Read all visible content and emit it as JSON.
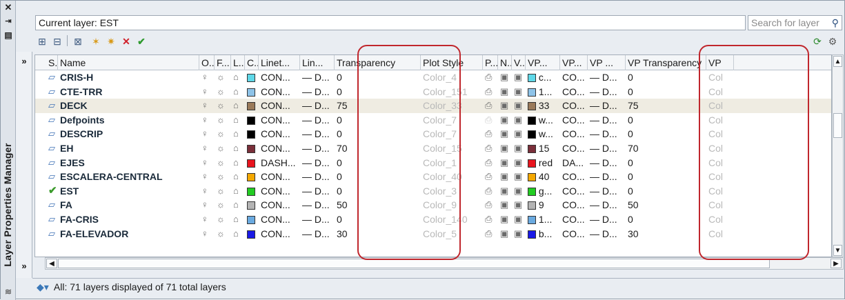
{
  "window": {
    "title": "Layer Properties Manager",
    "strip_icons": [
      "close-icon",
      "auto-hide-icon",
      "properties-icon",
      "layers-icon"
    ]
  },
  "header": {
    "current_layer": "Current layer: EST",
    "search_placeholder": "Search for layer"
  },
  "toolbar": {
    "icons": [
      "new-property-filter-icon",
      "new-group-filter-icon",
      "layer-states-manager-icon",
      "new-layer-icon",
      "new-layer-vp-frozen-icon",
      "delete-layer-icon",
      "set-current-icon"
    ],
    "right_icons": [
      "refresh-icon",
      "settings-icon"
    ]
  },
  "columns": [
    "S..",
    "Name",
    "O..",
    "F...",
    "L...",
    "C...",
    "Linet...",
    "Lin...",
    "Transparency",
    "Plot Style",
    "P...",
    "N...",
    "V...",
    "VP...",
    "VP...",
    "VP ...",
    "VP Transparency",
    "VP"
  ],
  "rows": [
    {
      "name": "CRIS-H",
      "color": "#5fd8e8",
      "linetype": "CON...",
      "lineweight": "— D...",
      "transparency": "0",
      "plot_style": "Color_4",
      "vp_color": "c...",
      "vp_linetype": "CO...",
      "vp_lineweight": "— D...",
      "vp_transparency": "0",
      "vp_plot": "Col",
      "current": false,
      "plot_disabled": false
    },
    {
      "name": "CTE-TRR",
      "color": "#8ec3e8",
      "linetype": "CON...",
      "lineweight": "— D...",
      "transparency": "0",
      "plot_style": "Color_151",
      "vp_color": "1...",
      "vp_linetype": "CO...",
      "vp_lineweight": "— D...",
      "vp_transparency": "0",
      "vp_plot": "Col",
      "current": false,
      "plot_disabled": false
    },
    {
      "name": "DECK",
      "color": "#9a7a5a",
      "linetype": "CON...",
      "lineweight": "— D...",
      "transparency": "75",
      "plot_style": "Color_33",
      "vp_color": "33",
      "vp_linetype": "CO...",
      "vp_lineweight": "— D...",
      "vp_transparency": "75",
      "vp_plot": "Col",
      "current": false,
      "plot_disabled": false,
      "selected": true
    },
    {
      "name": "Defpoints",
      "color": "#000000",
      "linetype": "CON...",
      "lineweight": "— D...",
      "transparency": "0",
      "plot_style": "Color_7",
      "vp_color": "w...",
      "vp_linetype": "CO...",
      "vp_lineweight": "— D...",
      "vp_transparency": "0",
      "vp_plot": "Col",
      "current": false,
      "plot_disabled": true
    },
    {
      "name": "DESCRIP",
      "color": "#000000",
      "linetype": "CON...",
      "lineweight": "— D...",
      "transparency": "0",
      "plot_style": "Color_7",
      "vp_color": "w...",
      "vp_linetype": "CO...",
      "vp_lineweight": "— D...",
      "vp_transparency": "0",
      "vp_plot": "Col",
      "current": false,
      "plot_disabled": false
    },
    {
      "name": "EH",
      "color": "#7a2f3a",
      "linetype": "CON...",
      "lineweight": "— D...",
      "transparency": "70",
      "plot_style": "Color_15",
      "vp_color": "15",
      "vp_linetype": "CO...",
      "vp_lineweight": "— D...",
      "vp_transparency": "70",
      "vp_plot": "Col",
      "current": false,
      "plot_disabled": false
    },
    {
      "name": "EJES",
      "color": "#e8141e",
      "linetype": "DASH...",
      "lineweight": "— D...",
      "transparency": "0",
      "plot_style": "Color_1",
      "vp_color": "red",
      "vp_linetype": "DA...",
      "vp_lineweight": "— D...",
      "vp_transparency": "0",
      "vp_plot": "Col",
      "current": false,
      "plot_disabled": false
    },
    {
      "name": "ESCALERA-CENTRAL",
      "color": "#f4a800",
      "linetype": "CON...",
      "lineweight": "— D...",
      "transparency": "0",
      "plot_style": "Color_40",
      "vp_color": "40",
      "vp_linetype": "CO...",
      "vp_lineweight": "— D...",
      "vp_transparency": "0",
      "vp_plot": "Col",
      "current": false,
      "plot_disabled": false
    },
    {
      "name": "EST",
      "color": "#22cc22",
      "linetype": "CON...",
      "lineweight": "— D...",
      "transparency": "0",
      "plot_style": "Color_3",
      "vp_color": "g...",
      "vp_linetype": "CO...",
      "vp_lineweight": "— D...",
      "vp_transparency": "0",
      "vp_plot": "Col",
      "current": true,
      "plot_disabled": false
    },
    {
      "name": "FA",
      "color": "#b4b4b4",
      "linetype": "CON...",
      "lineweight": "— D...",
      "transparency": "50",
      "plot_style": "Color_9",
      "vp_color": "9",
      "vp_linetype": "CO...",
      "vp_lineweight": "— D...",
      "vp_transparency": "50",
      "vp_plot": "Col",
      "current": false,
      "plot_disabled": false
    },
    {
      "name": "FA-CRIS",
      "color": "#6aaae0",
      "linetype": "CON...",
      "lineweight": "— D...",
      "transparency": "0",
      "plot_style": "Color_140",
      "vp_color": "1...",
      "vp_linetype": "CO...",
      "vp_lineweight": "— D...",
      "vp_transparency": "0",
      "vp_plot": "Col",
      "current": false,
      "plot_disabled": false
    },
    {
      "name": "FA-ELEVADOR",
      "color": "#1a1ae6",
      "linetype": "CON...",
      "lineweight": "— D...",
      "transparency": "30",
      "plot_style": "Color_5",
      "vp_color": "b...",
      "vp_linetype": "CO...",
      "vp_lineweight": "— D...",
      "vp_transparency": "30",
      "vp_plot": "Col",
      "current": false,
      "plot_disabled": false
    }
  ],
  "status": {
    "text": "All: 71 layers displayed of 71 total layers"
  },
  "glyphs": {
    "expand": "»",
    "close": "✕",
    "on": "💡",
    "thaw": "☼",
    "unlock": "🔓",
    "plot": "🖶",
    "layer_status": "▱",
    "current_status": "✔",
    "search": "🔍"
  }
}
